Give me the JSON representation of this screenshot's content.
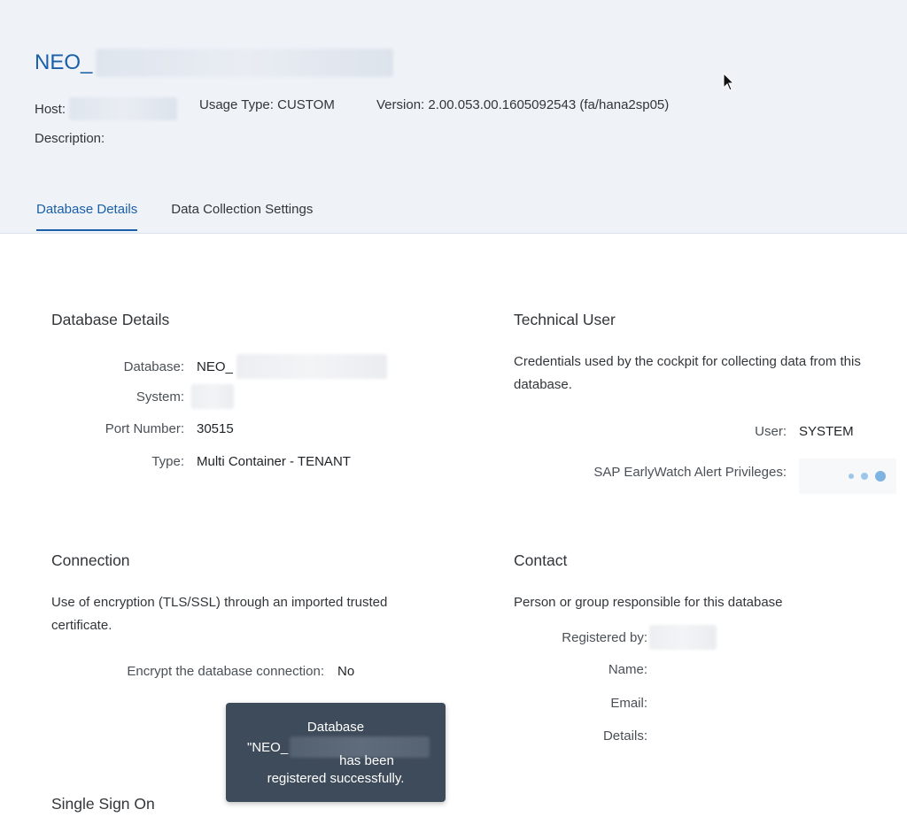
{
  "header": {
    "title_prefix": "NEO_",
    "host_label": "Host:",
    "usage_type": "Usage Type: CUSTOM",
    "version": "Version: 2.00.053.00.1605092543 (fa/hana2sp05)",
    "description_label": "Description:"
  },
  "tabs": [
    {
      "label": "Database Details",
      "active": true
    },
    {
      "label": "Data Collection Settings",
      "active": false
    }
  ],
  "database_details": {
    "title": "Database Details",
    "database_label": "Database:",
    "database_value": "NEO_",
    "system_label": "System:",
    "port_label": "Port Number:",
    "port_value": "30515",
    "type_label": "Type:",
    "type_value": "Multi Container - TENANT"
  },
  "technical_user": {
    "title": "Technical User",
    "description_line1": "Credentials used by the cockpit for collecting data from this",
    "description_line2": "database.",
    "user_label": "User:",
    "user_value": "SYSTEM",
    "ewa_label": "SAP EarlyWatch Alert Privileges:"
  },
  "connection": {
    "title": "Connection",
    "description_line1": "Use of encryption (TLS/SSL) through an imported trusted",
    "description_line2": "certificate.",
    "encrypt_label": "Encrypt the database connection:",
    "encrypt_value": "No"
  },
  "contact": {
    "title": "Contact",
    "description": "Person or group responsible for this database",
    "registered_by_label": "Registered by:",
    "name_label": "Name:",
    "email_label": "Email:",
    "details_label": "Details:"
  },
  "single_sign_on": {
    "title": "Single Sign On"
  },
  "toast": {
    "line1": "Database",
    "line2_prefix": "\"NEO_",
    "line3": "has been",
    "line4": "registered successfully."
  },
  "colors": {
    "accent": "#1a5fa8",
    "header_bg": "#eff3f8",
    "toast_bg": "#3e4b5a",
    "busy_dot": "#9cc6ea"
  }
}
